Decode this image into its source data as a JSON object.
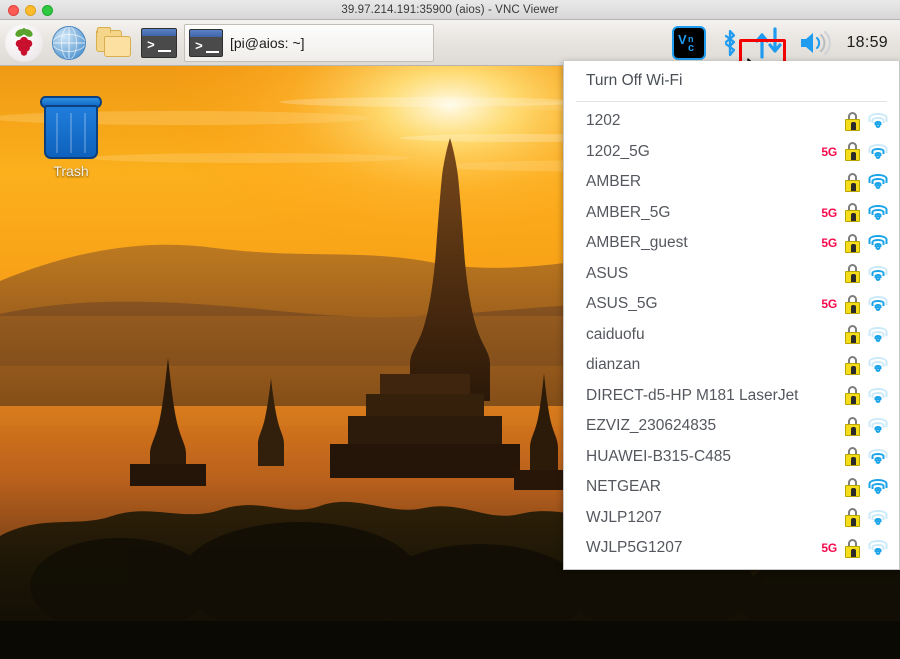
{
  "window": {
    "title": "39.97.214.191:35900 (aios) - VNC Viewer",
    "traffic_lights": [
      "close",
      "minimize",
      "maximize"
    ]
  },
  "taskbar": {
    "launchers": [
      {
        "name": "raspberry-menu",
        "icon": "raspberry-icon"
      },
      {
        "name": "web-browser",
        "icon": "globe-icon"
      },
      {
        "name": "file-manager",
        "icon": "folder-icon"
      },
      {
        "name": "terminal",
        "icon": "terminal-icon"
      }
    ],
    "window_button": {
      "label": "[pi@aios: ~]",
      "icon": "terminal-icon"
    },
    "tray": {
      "vnc": {
        "label": "VNC",
        "icon": "vnc-icon"
      },
      "bluetooth": {
        "icon": "bluetooth-icon"
      },
      "network": {
        "icon": "network-updown-icon",
        "highlighted": true
      },
      "volume": {
        "icon": "speaker-icon"
      },
      "clock": "18:59"
    }
  },
  "desktop": {
    "icons": [
      {
        "name": "trash",
        "label": "Trash",
        "icon": "trash-can-icon"
      }
    ]
  },
  "wifi_menu": {
    "toggle_label": "Turn Off Wi-Fi",
    "highlighted_network": "AMBER_5G",
    "band_label": "5G",
    "networks": [
      {
        "ssid": "1202",
        "band": "",
        "secured": true,
        "signal": 1
      },
      {
        "ssid": "1202_5G",
        "band": "5G",
        "secured": true,
        "signal": 2
      },
      {
        "ssid": "AMBER",
        "band": "",
        "secured": true,
        "signal": 3
      },
      {
        "ssid": "AMBER_5G",
        "band": "5G",
        "secured": true,
        "signal": 3
      },
      {
        "ssid": "AMBER_guest",
        "band": "5G",
        "secured": true,
        "signal": 3
      },
      {
        "ssid": "ASUS",
        "band": "",
        "secured": true,
        "signal": 2
      },
      {
        "ssid": "ASUS_5G",
        "band": "5G",
        "secured": true,
        "signal": 2
      },
      {
        "ssid": "caiduofu",
        "band": "",
        "secured": true,
        "signal": 1
      },
      {
        "ssid": "dianzan",
        "band": "",
        "secured": true,
        "signal": 1
      },
      {
        "ssid": "DIRECT-d5-HP M181 LaserJet",
        "band": "",
        "secured": true,
        "signal": 1
      },
      {
        "ssid": "EZVIZ_230624835",
        "band": "",
        "secured": true,
        "signal": 1
      },
      {
        "ssid": "HUAWEI-B315-C485",
        "band": "",
        "secured": true,
        "signal": 2
      },
      {
        "ssid": "NETGEAR",
        "band": "",
        "secured": true,
        "signal": 3
      },
      {
        "ssid": "WJLP1207",
        "band": "",
        "secured": true,
        "signal": 1
      },
      {
        "ssid": "WJLP5G1207",
        "band": "5G",
        "secured": true,
        "signal": 1
      }
    ]
  },
  "colors": {
    "accent_red": "#f40000",
    "band_5g": "#f50a4b",
    "wifi_blue": "#19a3e8",
    "lock_yellow": "#f5dd1a",
    "vnc_blue": "#1f9cf0"
  }
}
